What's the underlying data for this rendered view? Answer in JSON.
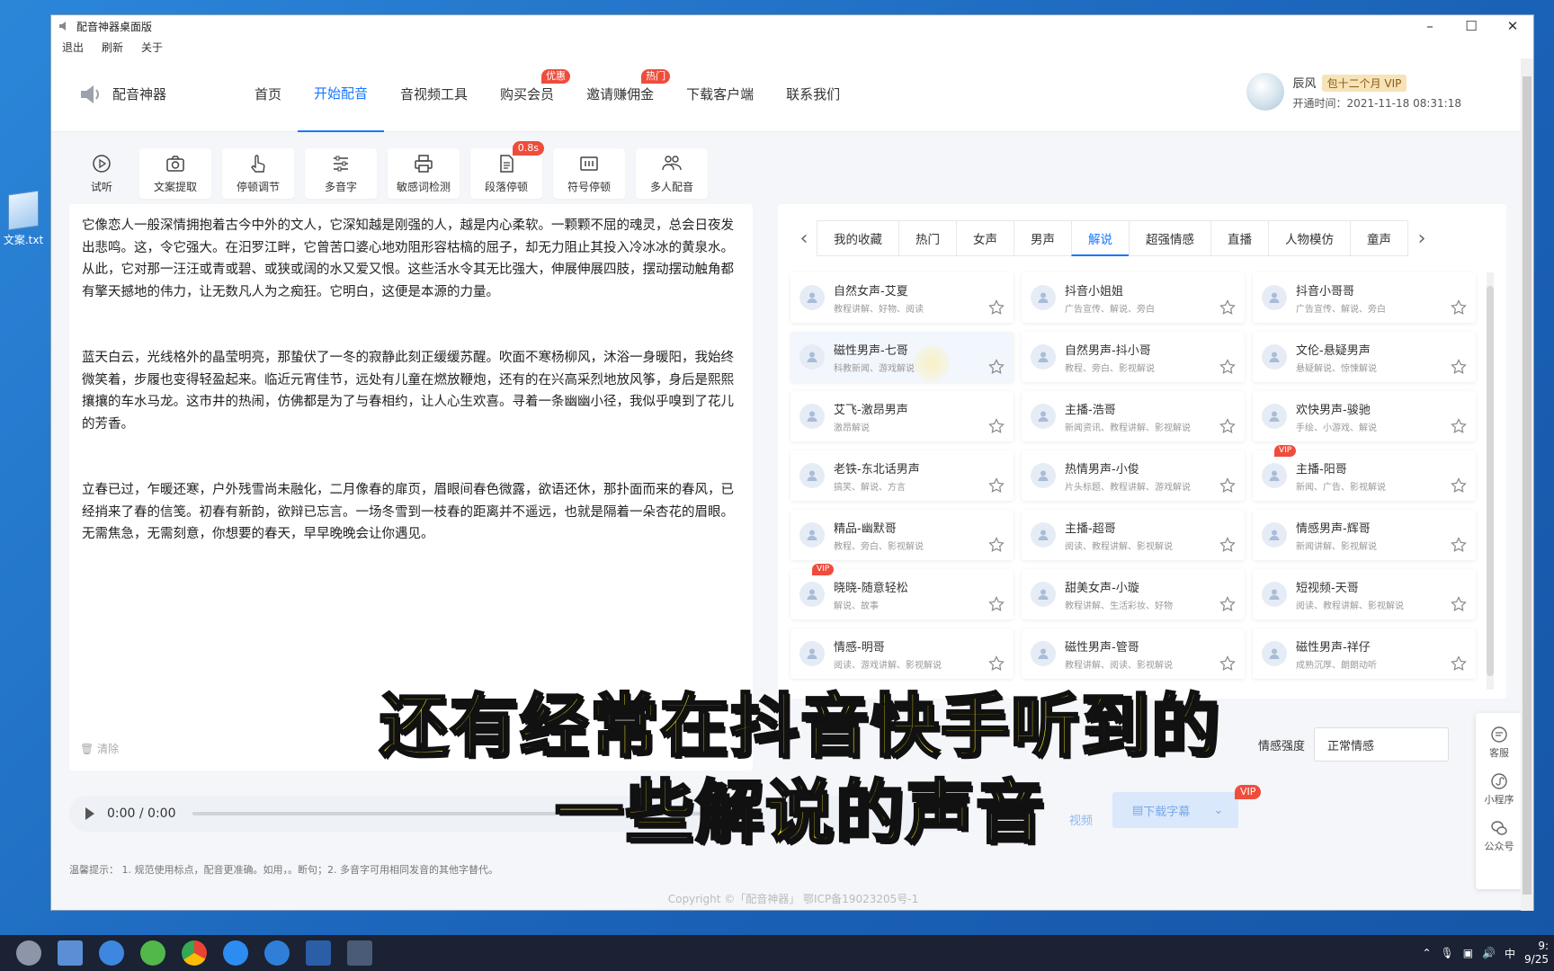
{
  "desktop": {
    "file_label": "文案.txt"
  },
  "window": {
    "title": "配音神器桌面版",
    "menu": [
      "退出",
      "刷新",
      "关于"
    ],
    "controls": {
      "minimize": "–",
      "maximize": "☐",
      "close": "✕"
    }
  },
  "header": {
    "logo_text": "配音神器",
    "nav": [
      {
        "label": "首页"
      },
      {
        "label": "开始配音",
        "active": true
      },
      {
        "label": "音视频工具"
      },
      {
        "label": "购买会员",
        "badge": "优惠"
      },
      {
        "label": "邀请赚佣金",
        "badge": "热门"
      },
      {
        "label": "下载客户端"
      },
      {
        "label": "联系我们"
      }
    ],
    "user": {
      "name": "辰风",
      "vip": "包十二个月 VIP",
      "time": "开通时间：2021-11-18 08:31:18"
    }
  },
  "toolbar": {
    "tools": [
      {
        "label": "试听",
        "icon": "play-circle-icon"
      },
      {
        "label": "文案提取",
        "icon": "camera-icon"
      },
      {
        "label": "停顿调节",
        "icon": "hand-pointer-icon"
      },
      {
        "label": "多音字",
        "icon": "sliders-icon"
      },
      {
        "label": "敏感词检测",
        "icon": "printer-icon"
      },
      {
        "label": "段落停顿",
        "icon": "document-icon",
        "badge": "0.8s"
      },
      {
        "label": "符号停顿",
        "icon": "pause-box-icon"
      },
      {
        "label": "多人配音",
        "icon": "people-icon"
      }
    ]
  },
  "editor": {
    "paragraphs": [
      "它像恋人一般深情拥抱着古今中外的文人，它深知越是刚强的人，越是内心柔软。一颗颗不屈的魂灵，总会日夜发出悲鸣。这，令它强大。在汨罗江畔，它曾苦口婆心地劝阻形容枯槁的屈子，却无力阻止其投入冷冰冰的黄泉水。从此，它对那一汪汪或青或碧、或狭或阔的水又爱又恨。这些活水令其无比强大，伸展伸展四肢，摆动摆动触角都有擎天撼地的伟力，让无数凡人为之痴狂。它明白，这便是本源的力量。",
      "蓝天白云，光线格外的晶莹明亮，那蛰伏了一冬的寂静此刻正缓缓苏醒。吹面不寒杨柳风，沐浴一身暖阳，我始终微笑着，步履也变得轻盈起来。临近元宵佳节，远处有儿童在燃放鞭炮，还有的在兴高采烈地放风筝，身后是熙熙攘攘的车水马龙。这市井的热闹，仿佛都是为了与春相约，让人心生欢喜。寻着一条幽幽小径，我似乎嗅到了花儿的芳香。",
      "立春已过，乍暖还寒，户外残雪尚未融化，二月像春的扉页，眉眼间春色微露，欲语还休，那扑面而来的春风，已经捎来了春的信笺。初春有新韵，欲辩已忘言。一场冬雪到一枝春的距离并不遥远，也就是隔着一朵杏花的眉眼。无需焦急，无需刻意，你想要的春天，早早晚晚会让你遇见。"
    ],
    "clear_label": "清除"
  },
  "voice_panel": {
    "tabs": [
      {
        "label": "我的收藏"
      },
      {
        "label": "热门"
      },
      {
        "label": "女声"
      },
      {
        "label": "男声"
      },
      {
        "label": "解说",
        "active": true
      },
      {
        "label": "超强情感"
      },
      {
        "label": "直播"
      },
      {
        "label": "人物模仿"
      },
      {
        "label": "童声"
      }
    ],
    "voices": [
      {
        "name": "自然女声-艾夏",
        "desc": "教程讲解、好物、阅读"
      },
      {
        "name": "抖音小姐姐",
        "desc": "广告宣传、解说、旁白"
      },
      {
        "name": "抖音小哥哥",
        "desc": "广告宣传、解说、旁白"
      },
      {
        "name": "磁性男声-七哥",
        "desc": "科教新闻、游戏解说",
        "hover": true
      },
      {
        "name": "自然男声-抖小哥",
        "desc": "教程、旁白、影视解说"
      },
      {
        "name": "文伦-悬疑男声",
        "desc": "悬疑解说、惊悚解说"
      },
      {
        "name": "艾飞-激昂男声",
        "desc": "激昂解说"
      },
      {
        "name": "主播-浩哥",
        "desc": "新闻资讯、教程讲解、影视解说"
      },
      {
        "name": "欢快男声-骏驰",
        "desc": "手绘、小游戏、解说"
      },
      {
        "name": "老铁-东北话男声",
        "desc": "搞笑、解说、方言"
      },
      {
        "name": "热情男声-小俊",
        "desc": "片头标题、教程讲解、游戏解说"
      },
      {
        "name": "主播-阳哥",
        "desc": "新闻、广告、影视解说",
        "vip": "VIP"
      },
      {
        "name": "精品-幽默哥",
        "desc": "教程、旁白、影视解说"
      },
      {
        "name": "主播-超哥",
        "desc": "阅读、教程讲解、影视解说"
      },
      {
        "name": "情感男声-辉哥",
        "desc": "新闻讲解、影视解说"
      },
      {
        "name": "晓晓-随意轻松",
        "desc": "解说、故事",
        "vip": "VIP"
      },
      {
        "name": "甜美女声-小璇",
        "desc": "教程讲解、生活彩妆、好物"
      },
      {
        "name": "短视频-天哥",
        "desc": "阅读、教程讲解、影视解说"
      },
      {
        "name": "情感-明哥",
        "desc": "阅读、游戏讲解、影视解说"
      },
      {
        "name": "磁性男声-管哥",
        "desc": "教程讲解、阅读、影视解说"
      },
      {
        "name": "磁性男声-祥仔",
        "desc": "成熟沉厚、朗朗动听"
      }
    ],
    "emotion_label": "情感强度",
    "emotion_value": "正常情感"
  },
  "player": {
    "time": "0:00 / 0:00",
    "video_label": "视频",
    "subtitle_label": "下载字幕",
    "subtitle_vip": "VIP"
  },
  "tip": "温馨提示： 1. 规范使用标点，配音更准确。如用，。断句；2. 多音字可用相同发音的其他字替代。",
  "copyright": "Copyright ©「配音神器」 鄂ICP备19023205号-1",
  "side_float": [
    "客服",
    "小程序",
    "公众号"
  ],
  "overlay_subtitle": [
    "还有经常在抖音快手听到的",
    "一些解说的声音"
  ],
  "taskbar": {
    "tray_lang": "中",
    "clock_time": "9:",
    "clock_date": "9/25"
  }
}
